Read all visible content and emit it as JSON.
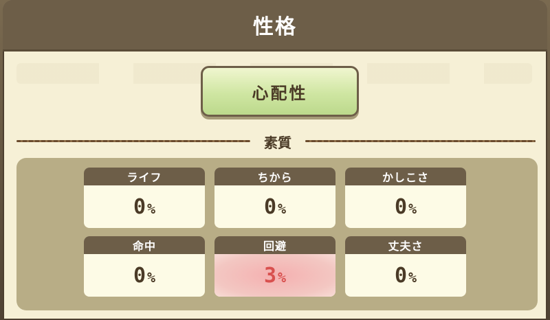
{
  "header": {
    "title": "性格"
  },
  "personality": {
    "label": "心配性"
  },
  "section": {
    "title": "素質"
  },
  "stats": [
    {
      "label": "ライフ",
      "value": "0",
      "unit": "%"
    },
    {
      "label": "ちから",
      "value": "0",
      "unit": "%"
    },
    {
      "label": "かしこさ",
      "value": "0",
      "unit": "%"
    },
    {
      "label": "命中",
      "value": "0",
      "unit": "%"
    },
    {
      "label": "回避",
      "value": "3",
      "unit": "%"
    },
    {
      "label": "丈夫さ",
      "value": "0",
      "unit": "%"
    }
  ],
  "colors": {
    "header_bg": "#6d5e48",
    "panel_bg": "#f6f0d6",
    "stats_bg": "#b8ad86",
    "highlight_text": "#d8504e",
    "highlight_bg": "#f4b0b0",
    "button_bg": "#cfe6a2"
  }
}
